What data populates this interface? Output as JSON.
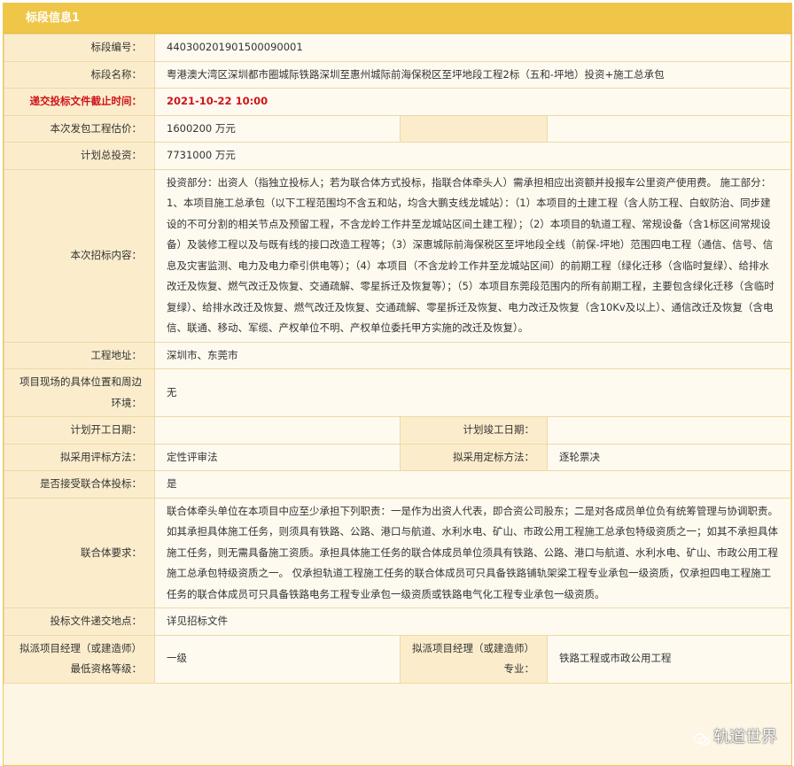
{
  "section_title": "标段信息1",
  "rows": {
    "bid_no": {
      "label": "标段编号：",
      "value": "440300201901500090001"
    },
    "bid_name": {
      "label": "标段名称：",
      "value": "粤港澳大湾区深圳都市圈城际铁路深圳至惠州城际前海保税区至坪地段工程2标（五和-坪地）投资+施工总承包"
    },
    "deadline": {
      "label": "递交投标文件截止时间：",
      "value": "2021-10-22 10:00"
    },
    "package_estimate": {
      "label": "本次发包工程估价：",
      "value": "1600200 万元"
    },
    "total_investment": {
      "label": "计划总投资：",
      "value": "7731000 万元"
    },
    "tender_content": {
      "label": "本次招标内容：",
      "value": "投资部分：出资人（指独立投标人；若为联合体方式投标，指联合体牵头人）需承担相应出资额并投报车公里资产使用费。 施工部分：1、本项目施工总承包（以下工程范围均不含五和站，均含大鹏支线龙城站）：（1）本项目的土建工程（含人防工程、白蚁防治、同步建设的不可分割的相关节点及预留工程，不含龙岭工作井至龙城站区间土建工程）；（2）本项目的轨道工程、常规设备（含1标区间常规设备）及装修工程以及与既有线的接口改造工程等；（3）深惠城际前海保税区至坪地段全线（前保-坪地）范围四电工程（通信、信号、信息及灾害监测、电力及电力牵引供电等）；（4）本项目（不含龙岭工作井至龙城站区间）的前期工程（绿化迁移（含临时复绿）、给排水改迁及恢复、燃气改迁及恢复、交通疏解、零星拆迁及恢复等）；（5）本项目东莞段范围内的所有前期工程，主要包含绿化迁移（含临时复绿）、给排水改迁及恢复、燃气改迁及恢复、交通疏解、零星拆迁及恢复、电力改迁及恢复（含10Kv及以上）、通信改迁及恢复（含电信、联通、移动、军缆、产权单位不明、产权单位委托甲方实施的改迁及恢复）。"
    },
    "address": {
      "label": "工程地址：",
      "value": "深圳市、东莞市"
    },
    "site_environment": {
      "label": "项目现场的具体位置和周边环境：",
      "value": "无"
    },
    "start_date": {
      "label": "计划开工日期：",
      "value": ""
    },
    "finish_date": {
      "label": "计划竣工日期：",
      "value": ""
    },
    "eval_method": {
      "label": "拟采用评标方法：",
      "value": "定性评审法"
    },
    "decide_method": {
      "label": "拟采用定标方法：",
      "value": "逐轮票决"
    },
    "consortium_accept": {
      "label": "是否接受联合体投标：",
      "value": "是"
    },
    "consortium_req": {
      "label": "联合体要求：",
      "value": "联合体牵头单位在本项目中应至少承担下列职责：一是作为出资人代表，即合资公司股东；二是对各成员单位负有统筹管理与协调职责。如其承担具体施工任务，则须具有铁路、公路、港口与航道、水利水电、矿山、市政公用工程施工总承包特级资质之一；如其不承担具体施工任务，则无需具备施工资质。承担具体施工任务的联合体成员单位须具有铁路、公路、港口与航道、水利水电、矿山、市政公用工程施工总承包特级资质之一。 仅承担轨道工程施工任务的联合体成员可只具备铁路铺轨架梁工程专业承包一级资质，仅承担四电工程施工任务的联合体成员可只具备铁路电务工程专业承包一级资质或铁路电气化工程专业承包一级资质。"
    },
    "submit_place": {
      "label": "投标文件递交地点：",
      "value": "详见招标文件"
    },
    "pm_grade": {
      "label": "拟派项目经理（或建造师）最低资格等级：",
      "value": "一级"
    },
    "pm_major": {
      "label": "拟派项目经理（或建造师）专业：",
      "value": "铁路工程或市政公用工程"
    }
  },
  "watermark": {
    "text": "轨道世界",
    "icon": "wechat-icon"
  }
}
